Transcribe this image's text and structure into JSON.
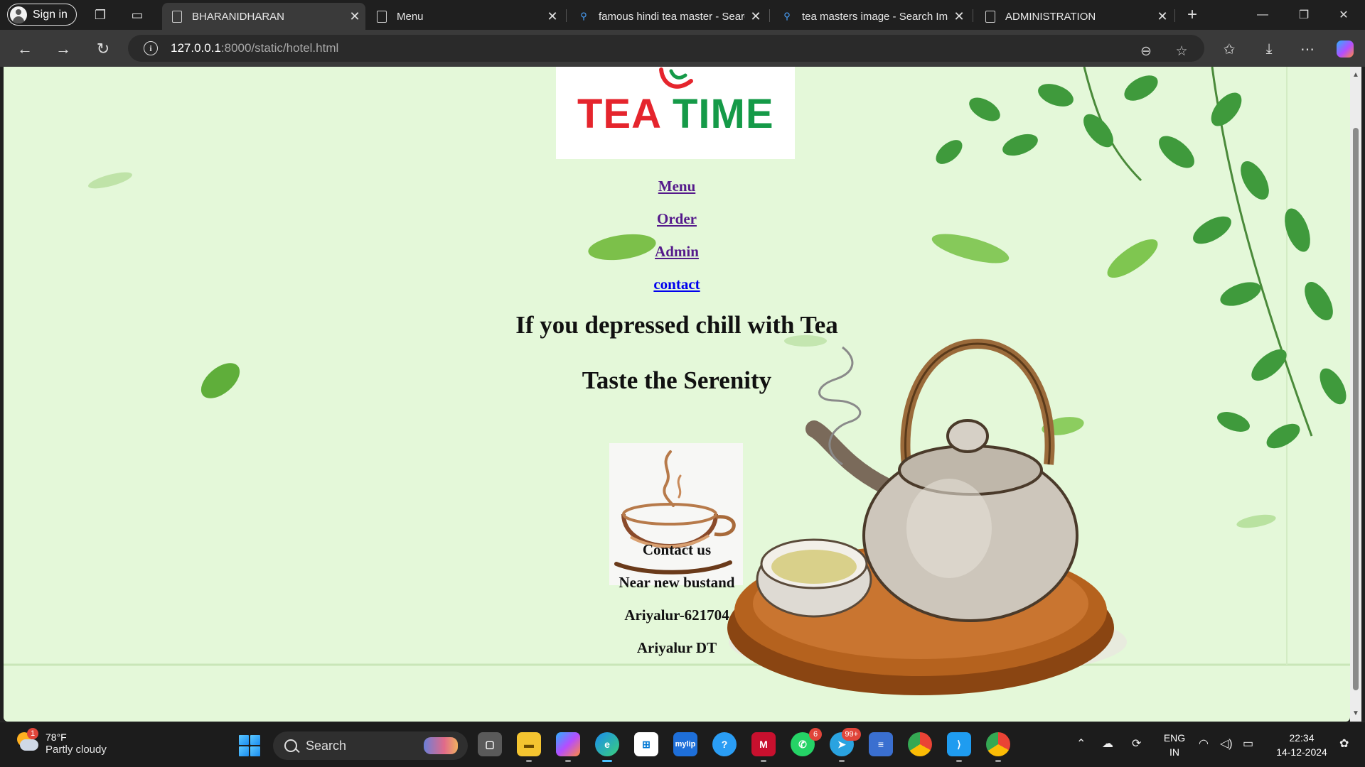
{
  "browser": {
    "signin_label": "Sign in",
    "tabs": [
      {
        "title": "BHARANIDHARAN",
        "icon": "page-icon",
        "active": true
      },
      {
        "title": "Menu",
        "icon": "page-icon"
      },
      {
        "title": "famous hindi tea master - Search",
        "icon": "search-icon"
      },
      {
        "title": "tea masters image - Search Images",
        "icon": "search-icon"
      },
      {
        "title": "ADMINISTRATION",
        "icon": "page-icon"
      }
    ],
    "url_host": "127.0.0.1",
    "url_path": ":8000/static/hotel.html"
  },
  "page": {
    "logo": {
      "part1": "TEA",
      "part2": "TIME"
    },
    "nav": [
      {
        "label": "Menu"
      },
      {
        "label": "Order"
      },
      {
        "label": "Admin"
      },
      {
        "label": "contact"
      }
    ],
    "headline1": "If you depressed chill with Tea",
    "headline2": "Taste the Serenity",
    "contact": [
      "Contact us",
      "Near new bustand",
      "Ariyalur-621704",
      "Ariyalur DT"
    ],
    "colors": {
      "background": "#e4f8d9",
      "logo_red": "#e5252d",
      "logo_green": "#159a48",
      "link_visited": "#551a8b",
      "link": "#0000ee"
    }
  },
  "taskbar": {
    "weather": {
      "temp": "78°F",
      "condition": "Partly cloudy",
      "badge": "1"
    },
    "search_label": "Search",
    "badges": {
      "whatsapp": "6",
      "telegram": "99+"
    },
    "lang_line1": "ENG",
    "lang_line2": "IN",
    "time": "22:34",
    "date": "14-12-2024"
  }
}
